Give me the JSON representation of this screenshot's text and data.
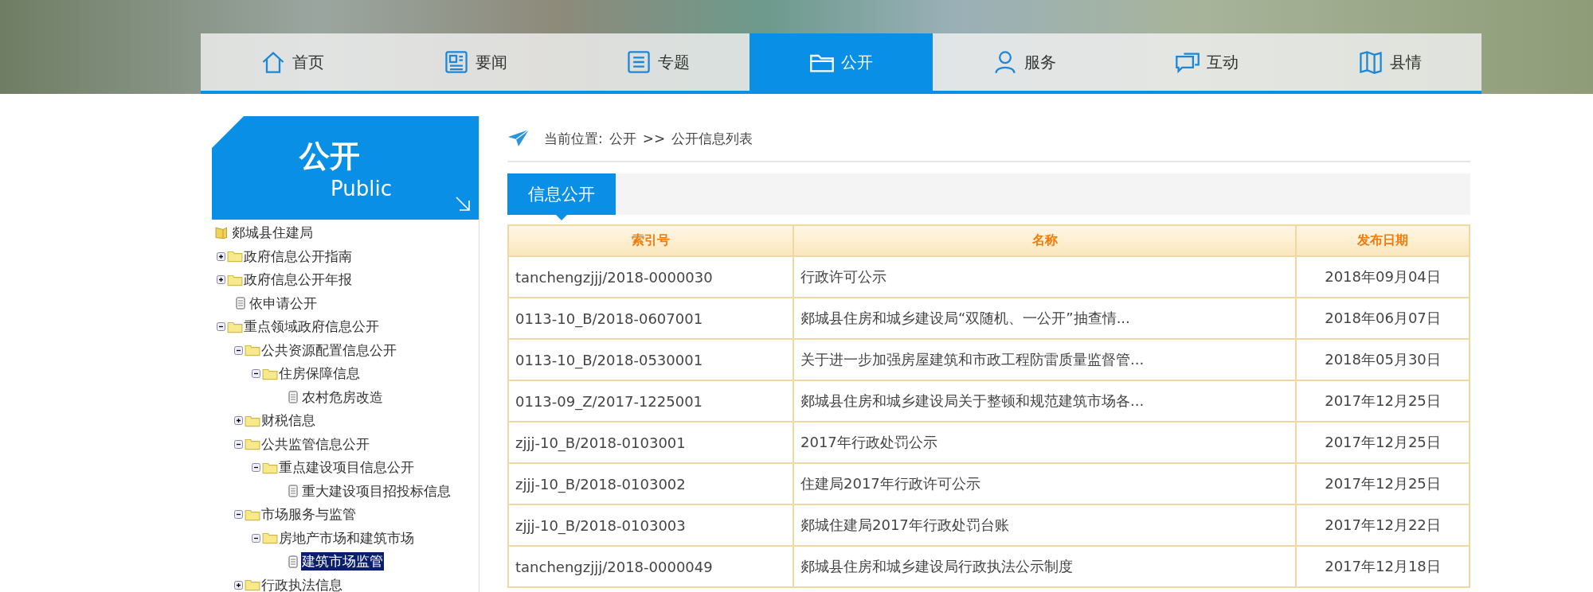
{
  "nav": [
    {
      "label": "首页",
      "selected": false
    },
    {
      "label": "要闻",
      "selected": false
    },
    {
      "label": "专题",
      "selected": false
    },
    {
      "label": "公开",
      "selected": true
    },
    {
      "label": "服务",
      "selected": false
    },
    {
      "label": "互动",
      "selected": false
    },
    {
      "label": "县情",
      "selected": false
    }
  ],
  "sidebar": {
    "title": "公开",
    "subtitle": "Public",
    "tree": [
      {
        "label": "郯城县住建局",
        "kind": "root",
        "selected": false,
        "children": [
          {
            "label": "政府信息公开指南",
            "kind": "folder",
            "expanded": false,
            "selected": false
          },
          {
            "label": "政府信息公开年报",
            "kind": "folder",
            "expanded": false,
            "selected": false
          },
          {
            "label": "依申请公开",
            "kind": "doc",
            "selected": false
          },
          {
            "label": "重点领域政府信息公开",
            "kind": "folder",
            "expanded": true,
            "selected": false,
            "children": [
              {
                "label": "公共资源配置信息公开",
                "kind": "folder",
                "expanded": true,
                "selected": false,
                "children": [
                  {
                    "label": "住房保障信息",
                    "kind": "folder",
                    "expanded": true,
                    "selected": false,
                    "children": [
                      {
                        "label": "农村危房改造",
                        "kind": "doc",
                        "selected": false
                      }
                    ]
                  }
                ]
              },
              {
                "label": "财税信息",
                "kind": "folder",
                "expanded": false,
                "selected": false
              },
              {
                "label": "公共监管信息公开",
                "kind": "folder",
                "expanded": true,
                "selected": false,
                "children": [
                  {
                    "label": "重点建设项目信息公开",
                    "kind": "folder",
                    "expanded": true,
                    "selected": false,
                    "children": [
                      {
                        "label": "重大建设项目招投标信息",
                        "kind": "doc",
                        "selected": false
                      }
                    ]
                  }
                ]
              },
              {
                "label": "市场服务与监管",
                "kind": "folder",
                "expanded": true,
                "selected": false,
                "children": [
                  {
                    "label": "房地产市场和建筑市场",
                    "kind": "folder",
                    "expanded": true,
                    "selected": false,
                    "children": [
                      {
                        "label": "建筑市场监管",
                        "kind": "doc",
                        "selected": true
                      }
                    ]
                  }
                ]
              },
              {
                "label": "行政执法信息",
                "kind": "folder",
                "expanded": false,
                "selected": false
              }
            ]
          }
        ]
      }
    ]
  },
  "breadcrumb": {
    "label": "当前位置:",
    "path": [
      "公开",
      "公开信息列表"
    ],
    "separator": ">>"
  },
  "tabs": [
    {
      "label": "信息公开",
      "selected": true
    }
  ],
  "table": {
    "columns": [
      "索引号",
      "名称",
      "发布日期"
    ],
    "rows": [
      [
        "tanchengzjjj/2018-0000030",
        "行政许可公示",
        "2018年09月04日"
      ],
      [
        "0113-10_B/2018-0607001",
        "郯城县住房和城乡建设局“双随机、一公开”抽查情...",
        "2018年06月07日"
      ],
      [
        "0113-10_B/2018-0530001",
        "关于进一步加强房屋建筑和市政工程防雷质量监督管...",
        "2018年05月30日"
      ],
      [
        "0113-09_Z/2017-1225001",
        "郯城县住房和城乡建设局关于整顿和规范建筑市场各...",
        "2017年12月25日"
      ],
      [
        "zjjj-10_B/2018-0103001",
        "2017年行政处罚公示",
        "2017年12月25日"
      ],
      [
        "zjjj-10_B/2018-0103002",
        "住建局2017年行政许可公示",
        "2017年12月25日"
      ],
      [
        "zjjj-10_B/2018-0103003",
        "郯城住建局2017年行政处罚台账",
        "2017年12月22日"
      ],
      [
        "tanchengzjjj/2018-0000049",
        "郯城县住房和城乡建设局行政执法公示制度",
        "2017年12月18日"
      ]
    ]
  }
}
